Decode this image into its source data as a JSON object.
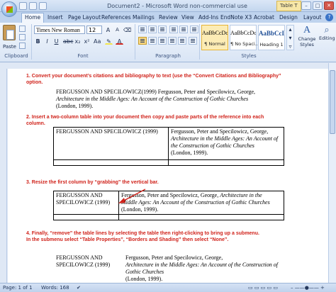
{
  "window": {
    "title": "Document2 - Microsoft Word non-commercial use",
    "context_tab": "Table T",
    "min": "–",
    "max": "□",
    "close": "✕"
  },
  "tabs": [
    "Home",
    "Insert",
    "Page Layout",
    "References",
    "Mailings",
    "Review",
    "View",
    "Add-Ins",
    "EndNote X3",
    "Acrobat",
    "Design",
    "Layout"
  ],
  "ribbon": {
    "clipboard": {
      "paste_label": "Paste",
      "group_label": "Clipboard"
    },
    "font": {
      "name": "Times New Roman",
      "size": "12",
      "group_label": "Font"
    },
    "paragraph": {
      "group_label": "Paragraph"
    },
    "styles": {
      "group_label": "Styles",
      "items": [
        {
          "sample": "AaBbCcDc",
          "name": "¶ Normal"
        },
        {
          "sample": "AaBbCcDc",
          "name": "¶ No Spaci..."
        },
        {
          "sample": "AaBbCcI",
          "name": "Heading 1"
        }
      ],
      "change_label": "Change Styles",
      "editing_label": "Editing"
    }
  },
  "document": {
    "step1": "1.  Convert your document’s citations and bibliography to text (use the “Convert Citations and Bibliography” option.",
    "step2": "2.  Insert a two-column table into your document then copy and paste parts of the reference into each column.",
    "step3": "3.  Resize the first column by “grabbing” the vertical bar.",
    "step4": "4.  Finally, “remove” the table lines by selecting the table then right-clicking to bring up a submenu.  In the submenu select “Table Properties”, “Borders and Shading” then select “None”.",
    "ref_key": "FERGUSSON AND SPECILOWICZ (1999)",
    "ref_key_line1": "FERGUSSON AND",
    "ref_key_line2": "SPECILOWICZ (1999)",
    "ref_authors": "Fergusson, Peter and Specilowicz, George,",
    "ref_title": "Architecture in the Middle Ages: An Account of the Construction of Gothic Churches",
    "ref_tail": "(London, 1999).",
    "ref_p1": "FERGUSSON AND SPECILOWICZ(1999) Fergusson, Peter and Specilowicz, George,",
    "ref_p2": "Architecture in the Middle Ages: An Account of the Construction of Gothic Churches",
    "ref_p3": "(London, 1999).",
    "t1_r1": "Fergusson, Peter and Specilowicz, George,",
    "t1_r2": "Architecture in the Middle Ages: An Account of the Construction of Gothic Churches",
    "t1_r3": "(London, 1999).",
    "t2_r1a": "Fergusson, Peter and Specilowicz, George,",
    "t2_r1b": "Architecture in the",
    "t2_r2": "Middle Ages: An Account of the Construction of Gothic Churches",
    "t2_r3": "(London, 1999)."
  },
  "status": {
    "page": "Page: 1 of 1",
    "words": "Words: 168"
  }
}
